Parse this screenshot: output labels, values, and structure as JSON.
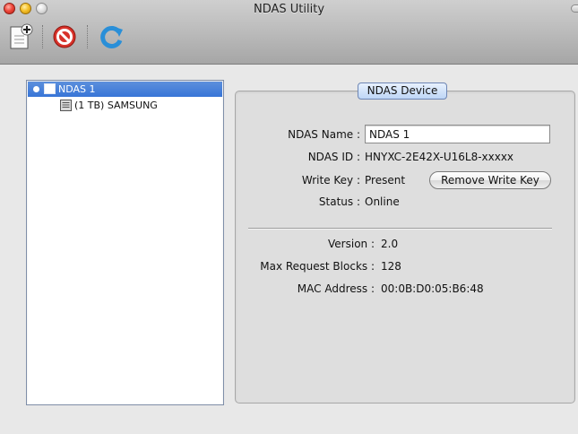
{
  "window": {
    "title": "NDAS Utility"
  },
  "toolbar": {
    "buttons": [
      {
        "name": "add-device",
        "icon": "add-document-icon"
      },
      {
        "name": "remove-device",
        "icon": "no-entry-icon"
      },
      {
        "name": "refresh",
        "icon": "refresh-icon"
      }
    ]
  },
  "device_list": {
    "items": [
      {
        "label": "NDAS 1",
        "selected": true,
        "icon": "device-icon"
      },
      {
        "label": "(1 TB) SAMSUNG",
        "selected": false,
        "icon": "disk-icon"
      }
    ]
  },
  "details": {
    "group_title": "NDAS Device",
    "name_label": "NDAS Name :",
    "name_value": "NDAS 1",
    "id_label": "NDAS ID :",
    "id_value": "HNYXC-2E42X-U16L8-xxxxx",
    "write_key_label": "Write Key :",
    "write_key_value": "Present",
    "remove_write_key_label": "Remove Write Key",
    "status_label": "Status :",
    "status_value": "Online",
    "version_label": "Version :",
    "version_value": "2.0",
    "max_blocks_label": "Max Request Blocks :",
    "max_blocks_value": "128",
    "mac_label": "MAC Address :",
    "mac_value": "00:0B:D0:05:B6:48"
  },
  "colors": {
    "selection": "#3875d7",
    "accent_blue": "#bed6f6",
    "stop_red": "#d8322a",
    "refresh_blue": "#2a8fd8"
  }
}
